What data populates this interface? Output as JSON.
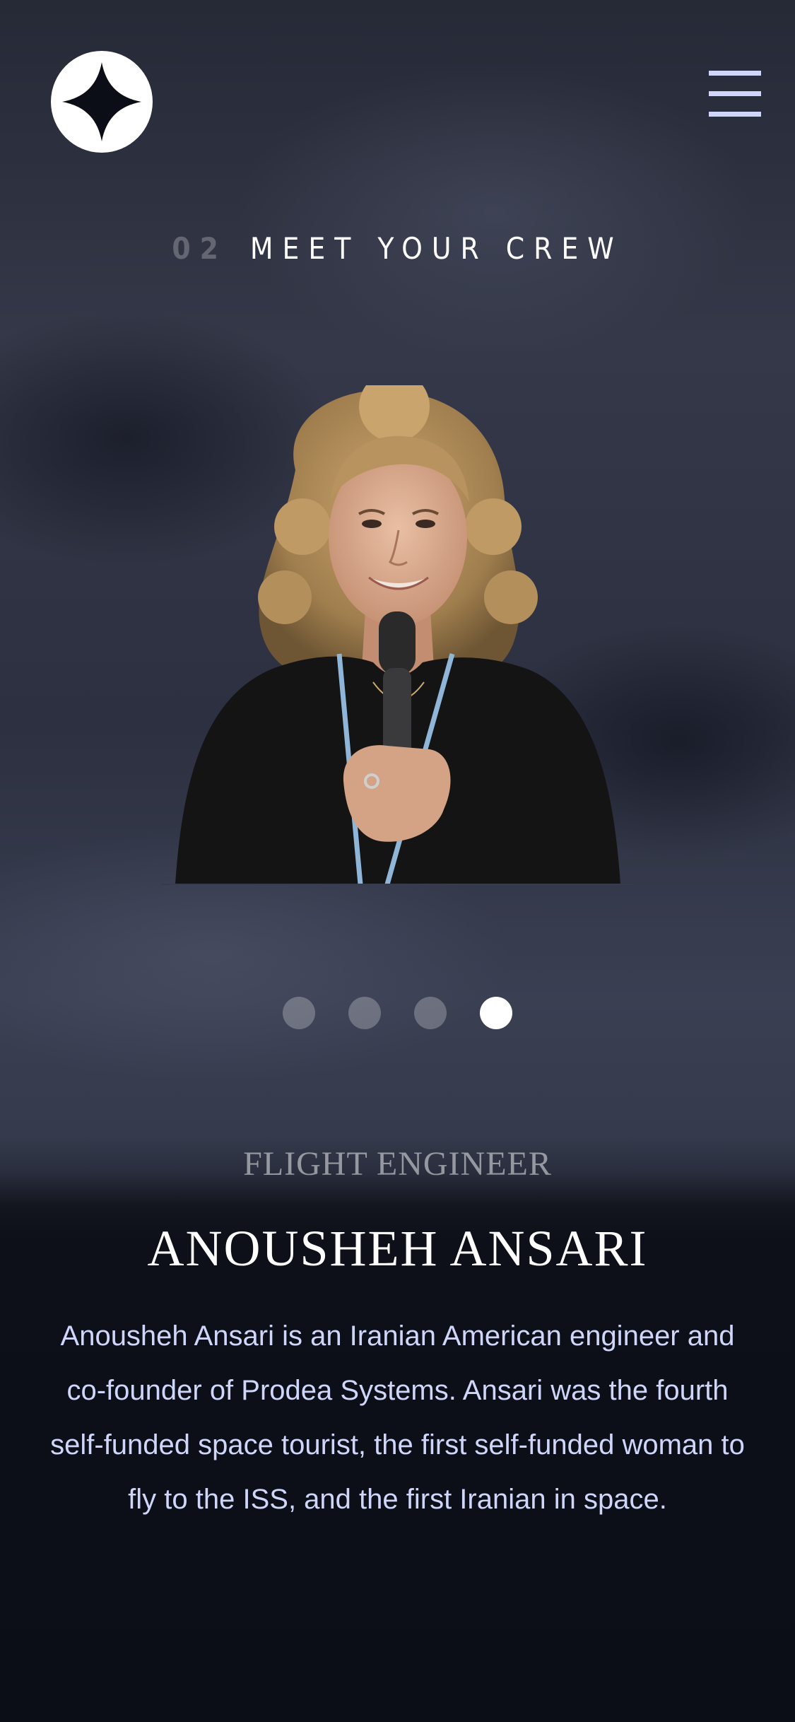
{
  "header": {
    "logo_icon": "star-logo-icon",
    "menu_icon": "hamburger-menu-icon"
  },
  "heading": {
    "number": "02",
    "title": "MEET YOUR CREW"
  },
  "crew": {
    "role": "FLIGHT ENGINEER",
    "name": "ANOUSHEH ANSARI",
    "bio": "Anousheh Ansari is an Iranian American engineer and co-founder of Prodea Systems. Ansari was the fourth self-funded space tourist, the first self-funded woman to fly to the ISS, and the first Iranian in space."
  },
  "pagination": {
    "total": 4,
    "active_index": 3
  },
  "colors": {
    "background_dark": "#0b0d17",
    "accent_light": "#d0d6f9",
    "white": "#ffffff"
  }
}
